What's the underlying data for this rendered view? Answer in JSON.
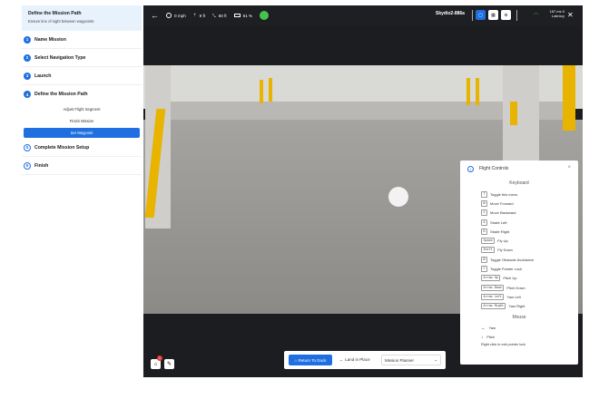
{
  "sidebar": {
    "hint_title": "Define the Mission Path",
    "hint_text": "Ensure line of sight between waypoints",
    "steps": [
      {
        "num": "1",
        "label": "Name Mission"
      },
      {
        "num": "2",
        "label": "Select Navigation Type"
      },
      {
        "num": "3",
        "label": "Launch"
      },
      {
        "num": "4",
        "label": "Define the Mission Path"
      },
      {
        "num": "5",
        "label": "Complete Mission Setup"
      },
      {
        "num": "6",
        "label": "Finish"
      }
    ],
    "substeps": [
      "Adjust Flight Segment",
      "Finish Mission",
      "Set Waypoint"
    ]
  },
  "topbar": {
    "speed": "0 mph",
    "altitude": "9 ft",
    "distance": "60 ft",
    "battery": "61 %",
    "drone_name": "Skydio2-886a",
    "latency_value": "167 ms",
    "latency_label": "Latency",
    "signal": "0"
  },
  "bottom": {
    "notification_count": "1",
    "return_to_dock": "Return To Dock",
    "land_in_place": "Land in Place",
    "mission_planner": "Mission Planner"
  },
  "flight_controls": {
    "title": "Flight Controls",
    "keyboard_header": "Keyboard",
    "keyboard": [
      {
        "key": "?",
        "action": "Toggle this menu"
      },
      {
        "key": "W",
        "action": "Move Forward"
      },
      {
        "key": "S",
        "action": "Move Backward"
      },
      {
        "key": "A",
        "action": "Strafe Left"
      },
      {
        "key": "D",
        "action": "Strafe Right"
      },
      {
        "key": "Space",
        "action": "Fly Up"
      },
      {
        "key": "Shift",
        "action": "Fly Down"
      },
      {
        "key": "B",
        "action": "Toggle Obstacle Avoidance"
      },
      {
        "key": "C",
        "action": "Toggle Pointer Lock"
      },
      {
        "key": "Arrow Up",
        "action": "Pitch Up"
      },
      {
        "key": "Arrow Down",
        "action": "Pitch Down"
      },
      {
        "key": "Arrow Left",
        "action": "Yaw Left"
      },
      {
        "key": "Arrow Right",
        "action": "Yaw Right"
      }
    ],
    "mouse_header": "Mouse",
    "mouse": [
      {
        "icon": "↔",
        "action": "Yaw"
      },
      {
        "icon": "↕",
        "action": "Pitch"
      }
    ],
    "footer": "Right click to exit pointer lock"
  }
}
